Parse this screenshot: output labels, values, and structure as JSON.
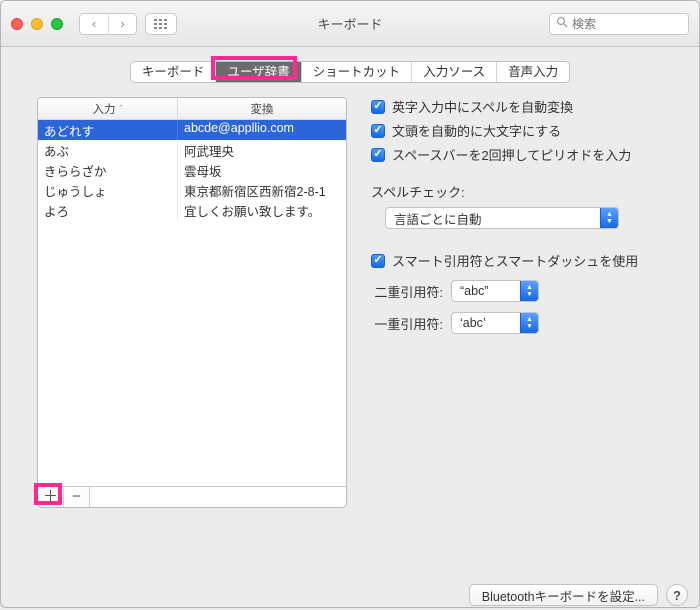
{
  "window": {
    "title": "キーボード"
  },
  "search": {
    "placeholder": "検索"
  },
  "tabs": [
    {
      "label": "キーボード",
      "selected": false
    },
    {
      "label": "ユーザ辞書",
      "selected": true
    },
    {
      "label": "ショートカット",
      "selected": false
    },
    {
      "label": "入力ソース",
      "selected": false
    },
    {
      "label": "音声入力",
      "selected": false
    }
  ],
  "table": {
    "cols": {
      "input": "入力",
      "output": "変換"
    },
    "rows": [
      {
        "in": "あどれす",
        "out": "abcde@appllio.com",
        "selected": true
      },
      {
        "in": "あぶ",
        "out": "阿武理央"
      },
      {
        "in": "きららざか",
        "out": "雲母坂"
      },
      {
        "in": "じゅうしょ",
        "out": "東京都新宿区西新宿2-8-1"
      },
      {
        "in": "よろ",
        "out": "宜しくお願い致します。"
      }
    ]
  },
  "buttons": {
    "add": "＋",
    "remove": "−"
  },
  "checks": {
    "spell": "英字入力中にスペルを自動変換",
    "capitalize": "文頭を自動的に大文字にする",
    "doubleSpace": "スペースバーを2回押してピリオドを入力",
    "smart": "スマート引用符とスマートダッシュを使用"
  },
  "spellcheck": {
    "label": "スペルチェック:",
    "value": "言語ごとに自動"
  },
  "quotes": {
    "doubleLabel": "二重引用符:",
    "doubleValue": "“abc”",
    "singleLabel": "一重引用符:",
    "singleValue": "‘abc’"
  },
  "footer": {
    "bluetooth": "Bluetoothキーボードを設定...",
    "help": "?"
  },
  "highlight": {
    "tab": 1,
    "addButton": true
  }
}
